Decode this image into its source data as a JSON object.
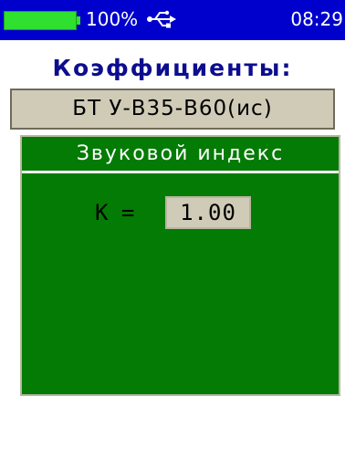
{
  "status_bar": {
    "battery_percent_text": "100%",
    "battery_level": 1.0,
    "usb_icon": "usb-icon",
    "time": "08:29"
  },
  "screen": {
    "title": "Коэффициенты:",
    "material": "БТ У-В35-В60(ис)",
    "panel": {
      "header": "Звуковой индекс",
      "k_label": "К =",
      "k_value": "1.00"
    }
  },
  "colors": {
    "status_bar_bg": "#0000cc",
    "battery_fill": "#2fe02f",
    "title_text": "#0d0d8f",
    "panel_bg": "#047b04",
    "field_bg": "#cfcbb7"
  }
}
